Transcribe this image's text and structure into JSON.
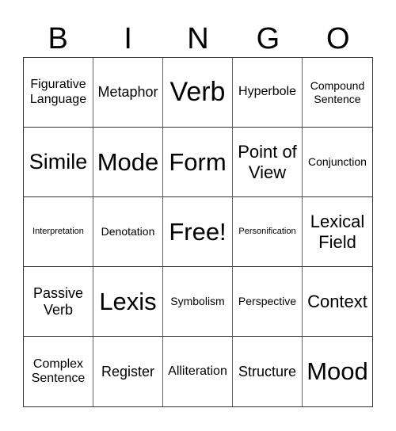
{
  "header": [
    "B",
    "I",
    "N",
    "G",
    "O"
  ],
  "cells": [
    {
      "text": "Figurative Language",
      "size": "s3"
    },
    {
      "text": "Metaphor",
      "size": "s4"
    },
    {
      "text": "Verb",
      "size": "s8"
    },
    {
      "text": "Hyperbole",
      "size": "s3"
    },
    {
      "text": "Compound Sentence",
      "size": "s2"
    },
    {
      "text": "Simile",
      "size": "s6"
    },
    {
      "text": "Mode",
      "size": "s7"
    },
    {
      "text": "Form",
      "size": "s7"
    },
    {
      "text": "Point of View",
      "size": "s5"
    },
    {
      "text": "Conjunction",
      "size": "s2"
    },
    {
      "text": "Interpretation",
      "size": "s1"
    },
    {
      "text": "Denotation",
      "size": "s2"
    },
    {
      "text": "Free!",
      "size": "s7"
    },
    {
      "text": "Personification",
      "size": "s1"
    },
    {
      "text": "Lexical Field",
      "size": "s5"
    },
    {
      "text": "Passive Verb",
      "size": "s4"
    },
    {
      "text": "Lexis",
      "size": "s7"
    },
    {
      "text": "Symbolism",
      "size": "s2"
    },
    {
      "text": "Perspective",
      "size": "s2"
    },
    {
      "text": "Context",
      "size": "s5"
    },
    {
      "text": "Complex Sentence",
      "size": "s3"
    },
    {
      "text": "Register",
      "size": "s4"
    },
    {
      "text": "Alliteration",
      "size": "s3"
    },
    {
      "text": "Structure",
      "size": "s4"
    },
    {
      "text": "Mood",
      "size": "s7"
    }
  ]
}
